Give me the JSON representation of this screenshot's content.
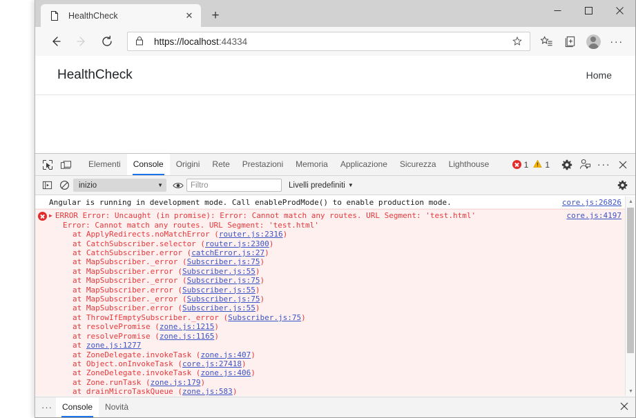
{
  "window": {
    "controls": {
      "minimize": "–",
      "maximize": "□",
      "close": "✕"
    }
  },
  "tabstrip": {
    "tab_title": "HealthCheck",
    "tab_close": "✕",
    "new_tab": "+"
  },
  "addressbar": {
    "url_prefix": "https://localhost",
    "url_port": ":44334",
    "back": "←",
    "forward": "→",
    "reload": "↻",
    "more": "···"
  },
  "page": {
    "brand": "HealthCheck",
    "nav_home": "Home"
  },
  "devtools": {
    "tabs": [
      {
        "label": "Elementi",
        "active": false
      },
      {
        "label": "Console",
        "active": true
      },
      {
        "label": "Origini",
        "active": false
      },
      {
        "label": "Rete",
        "active": false
      },
      {
        "label": "Prestazioni",
        "active": false
      },
      {
        "label": "Memoria",
        "active": false
      },
      {
        "label": "Applicazione",
        "active": false
      },
      {
        "label": "Sicurezza",
        "active": false
      },
      {
        "label": "Lighthouse",
        "active": false
      }
    ],
    "badges": {
      "errors": "1",
      "warnings": "1"
    },
    "more": "···",
    "close": "✕",
    "filterbar": {
      "context": "inizio",
      "context_caret": "▼",
      "filter_placeholder": "Filtro",
      "levels_label": "Livelli predefiniti",
      "levels_caret": "▼"
    },
    "drawer": {
      "dots": "···",
      "tabs": [
        {
          "label": "Console",
          "active": true
        },
        {
          "label": "Novità",
          "active": false
        }
      ],
      "close": "✕"
    }
  },
  "console": {
    "messages": [
      {
        "type": "info",
        "text": "Angular is running in development mode. Call enableProdMode() to enable production mode.",
        "source": "core.js:26826"
      },
      {
        "type": "error",
        "triangle": "▶",
        "headline": "ERROR Error: Uncaught (in promise): Error: Cannot match any routes. URL Segment: 'test.html'",
        "subline": "Error: Cannot match any routes. URL Segment: 'test.html'",
        "source": "core.js:4197",
        "stack": [
          {
            "fn": "at ApplyRedirects.noMatchError (",
            "link": "router.js:2316",
            "tail": ")"
          },
          {
            "fn": "at CatchSubscriber.selector (",
            "link": "router.js:2300",
            "tail": ")"
          },
          {
            "fn": "at CatchSubscriber.error (",
            "link": "catchError.js:27",
            "tail": ")"
          },
          {
            "fn": "at MapSubscriber._error (",
            "link": "Subscriber.js:75",
            "tail": ")"
          },
          {
            "fn": "at MapSubscriber.error (",
            "link": "Subscriber.js:55",
            "tail": ")"
          },
          {
            "fn": "at MapSubscriber._error (",
            "link": "Subscriber.js:75",
            "tail": ")"
          },
          {
            "fn": "at MapSubscriber.error (",
            "link": "Subscriber.js:55",
            "tail": ")"
          },
          {
            "fn": "at MapSubscriber._error (",
            "link": "Subscriber.js:75",
            "tail": ")"
          },
          {
            "fn": "at MapSubscriber.error (",
            "link": "Subscriber.js:55",
            "tail": ")"
          },
          {
            "fn": "at ThrowIfEmptySubscriber._error (",
            "link": "Subscriber.js:75",
            "tail": ")"
          },
          {
            "fn": "at resolvePromise (",
            "link": "zone.js:1215",
            "tail": ")"
          },
          {
            "fn": "at resolvePromise (",
            "link": "zone.js:1165",
            "tail": ")"
          },
          {
            "fn": "at ",
            "link": "zone.js:1277",
            "tail": ""
          },
          {
            "fn": "at ZoneDelegate.invokeTask (",
            "link": "zone.js:407",
            "tail": ")"
          },
          {
            "fn": "at Object.onInvokeTask (",
            "link": "core.js:27418",
            "tail": ")"
          },
          {
            "fn": "at ZoneDelegate.invokeTask (",
            "link": "zone.js:406",
            "tail": ")"
          },
          {
            "fn": "at Zone.runTask (",
            "link": "zone.js:179",
            "tail": ")"
          },
          {
            "fn": "at drainMicroTaskQueue (",
            "link": "zone.js:583",
            "tail": ")"
          }
        ]
      }
    ]
  },
  "colors": {
    "error_red": "#e4393c",
    "error_bg": "#fff0f0",
    "link_blue": "#3b53c4",
    "accent_blue": "#1a73e8",
    "warning_yellow": "#f5b400"
  }
}
